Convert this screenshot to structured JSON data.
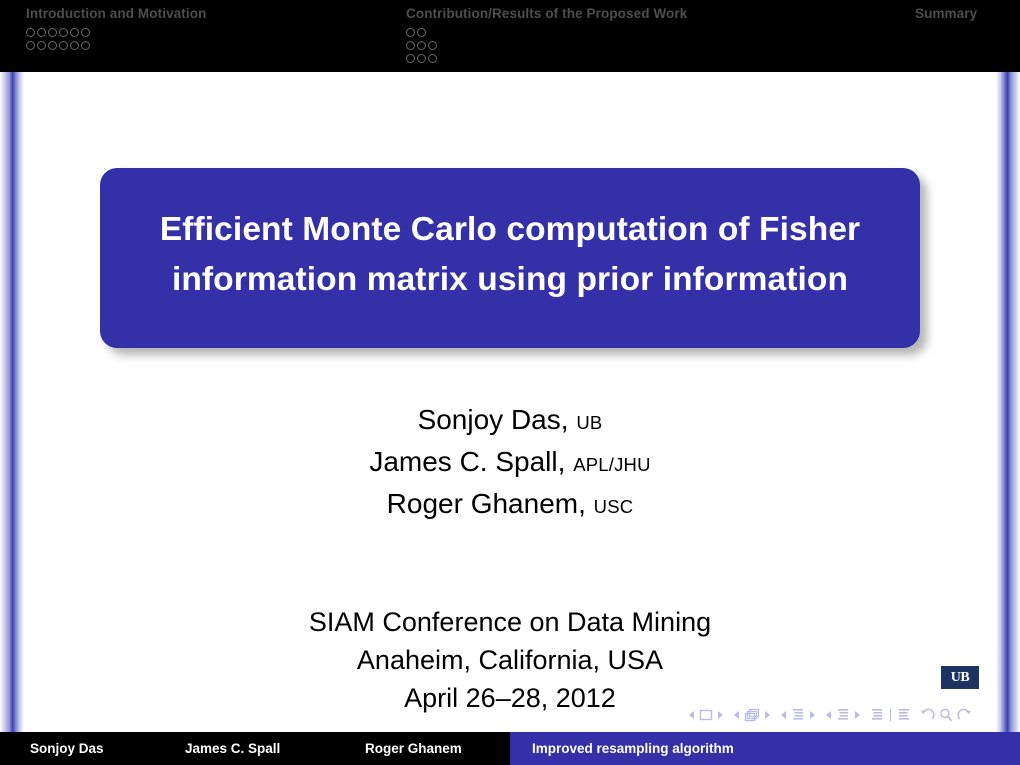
{
  "header": {
    "sections": [
      {
        "label": "Introduction and Motivation",
        "dot_rows": [
          6,
          6
        ]
      },
      {
        "label": "Contribution/Results of the Proposed Work",
        "dot_rows": [
          2,
          3,
          3
        ]
      },
      {
        "label": "Summary",
        "dot_rows": []
      }
    ]
  },
  "title": {
    "text": "Efficient Monte Carlo computation of Fisher information matrix using prior information",
    "box_color": "#3330A8",
    "text_color": "#FFFFFF"
  },
  "authors": [
    {
      "name": "Sonjoy Das,",
      "affiliation": "UB"
    },
    {
      "name": "James C. Spall,",
      "affiliation": "APL/JHU"
    },
    {
      "name": "Roger Ghanem,",
      "affiliation": "USC"
    }
  ],
  "conference": {
    "name": "SIAM Conference on Data Mining",
    "location": "Anaheim, California, USA",
    "dates": "April 26–28, 2012"
  },
  "logo": {
    "text": "UB",
    "background": "#1D3461"
  },
  "nav_symbols": {
    "items": [
      "slide-prev-icon",
      "slide-icon",
      "slide-next-icon",
      "frame-prev-icon",
      "frame-icon",
      "frame-next-icon",
      "subsection-prev-icon",
      "subsection-icon",
      "subsection-next-icon",
      "section-prev-icon",
      "section-icon",
      "section-next-icon",
      "beginning-icon",
      "end-icon",
      "back-icon",
      "search-icon",
      "forward-icon"
    ],
    "color": "#B9BCE3"
  },
  "footer": {
    "segments": [
      {
        "label": "Sonjoy Das",
        "background": "#000000"
      },
      {
        "label": "James C. Spall",
        "background": "#000000"
      },
      {
        "label": "Roger Ghanem",
        "background": "#000000"
      },
      {
        "label": "Improved resampling algorithm",
        "background": "#3330A8"
      }
    ]
  }
}
